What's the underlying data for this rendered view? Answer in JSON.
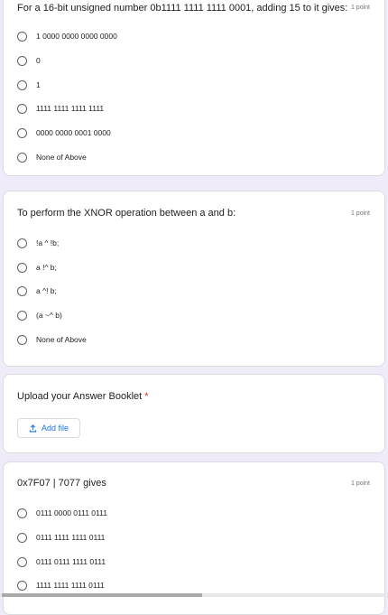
{
  "questions": [
    {
      "title": "For a 16-bit unsigned number 0b1111 1111 1111 0001, adding 15 to it gives:",
      "points": "1 point",
      "options": [
        "1 0000 0000 0000 0000",
        "0",
        "1",
        "1111 1111 1111 1111",
        "0000 0000 0001 0000",
        "None of Above"
      ]
    },
    {
      "title": "To perform the XNOR operation between a and b:",
      "points": "1 point",
      "options": [
        "!a ^ !b;",
        "a !^ b;",
        "a ^! b;",
        "(a ~^ b)",
        "None of Above"
      ]
    },
    {
      "title": "0x7F07 | 7077 gives",
      "points": "1 point",
      "options": [
        "0111 0000 0111 0111",
        "0111 1111 1111 0111",
        "0111 0111 1111 0111",
        "1111 1111 1111 0111"
      ]
    }
  ],
  "upload": {
    "title": "Upload your Answer Booklet",
    "required_mark": "*",
    "button_label": "Add file",
    "icon": "upload-icon"
  },
  "colors": {
    "background": "#f0ebf8",
    "accent": "#1a73e8",
    "required": "#d93025"
  }
}
